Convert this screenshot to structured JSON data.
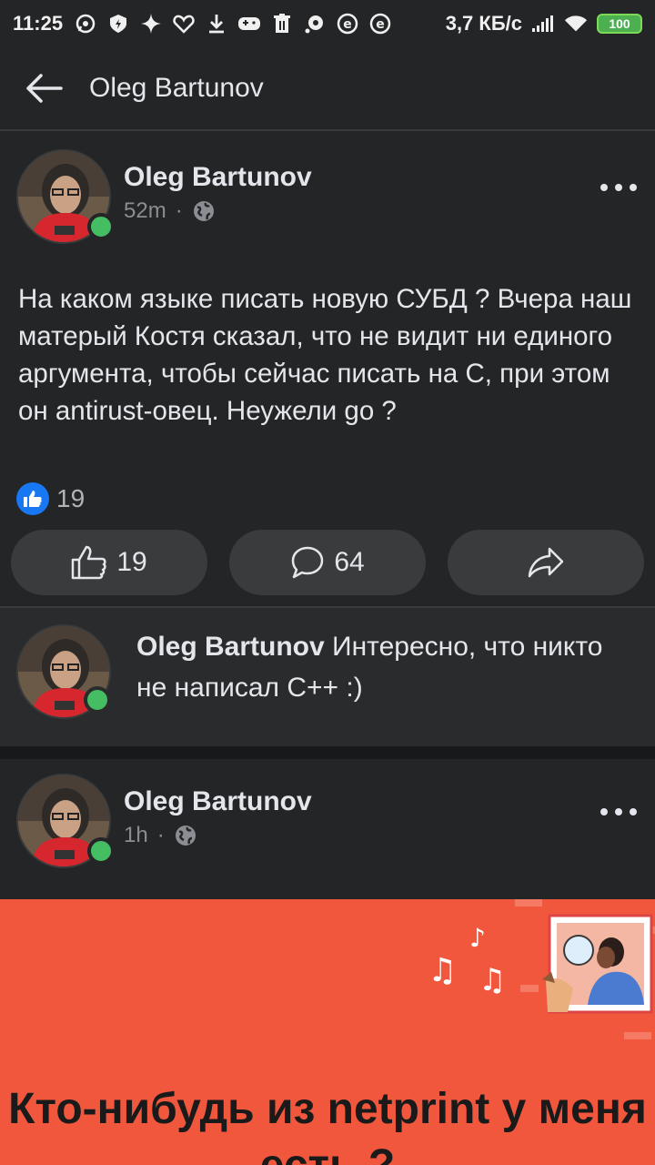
{
  "status_bar": {
    "time": "11:25",
    "network_speed": "3,7 КБ/с",
    "battery": "100",
    "icons": [
      "whatsapp-icon",
      "shield-icon",
      "sparkle-icon",
      "heart-icon",
      "download-icon",
      "gamepad-icon",
      "trash-icon",
      "podcast-icon",
      "e-icon",
      "e-icon",
      "signal-icon",
      "wifi-icon"
    ]
  },
  "header": {
    "title": "Oleg Bartunov"
  },
  "post1": {
    "author": "Oleg Bartunov",
    "time": "52m",
    "privacy_icon": "globe-icon",
    "text": "На каком языке писать новую СУБД ? Вчера наш матерый Костя сказал, что не видит ни единого аргумента, чтобы сейчас писать на С, при этом он antirust-овец.  Неужели go ?",
    "reaction_count": "19",
    "actions": {
      "like_count": "19",
      "comment_count": "64"
    }
  },
  "comment": {
    "author": "Oleg Bartunov",
    "text": "Интересно, что никто не написал C++  :)"
  },
  "post2": {
    "author": "Oleg Bartunov",
    "time": "1h",
    "privacy_icon": "globe-icon",
    "banner_text": "Кто-нибудь из netprint у меня есть ?"
  },
  "colors": {
    "background": "#242526",
    "online": "#45bd62",
    "like_blue": "#1877f2",
    "banner": "#f1573d"
  }
}
